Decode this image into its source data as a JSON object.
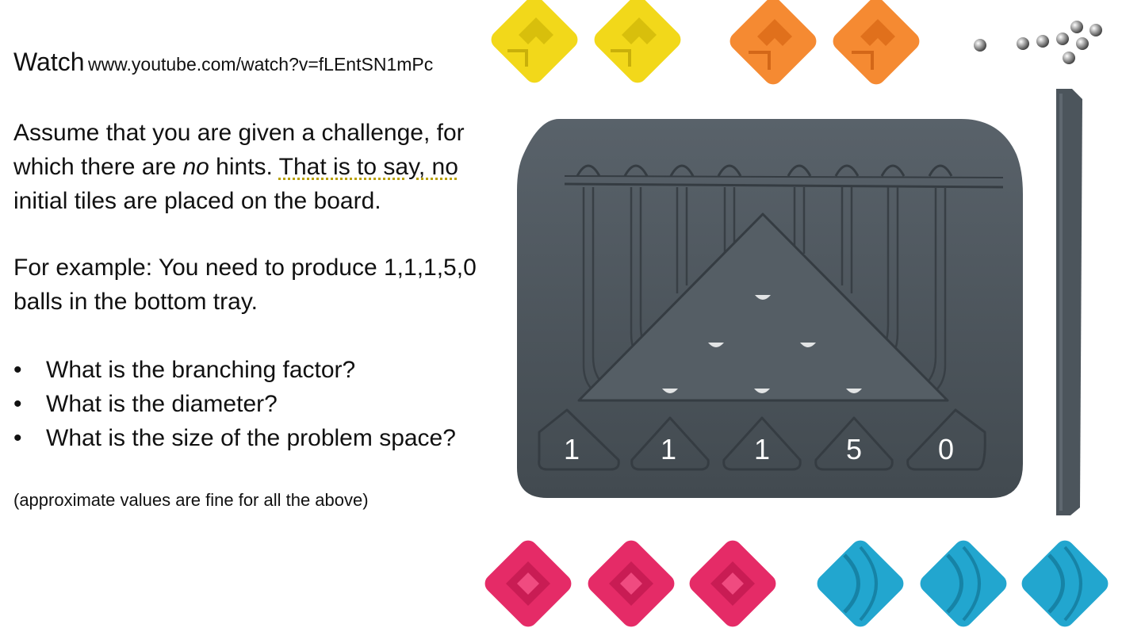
{
  "watch": {
    "label": "Watch",
    "url": "www.youtube.com/watch?v=fLEntSN1mPc"
  },
  "intro": {
    "part1": "Assume that you are given a challenge, for which there are ",
    "emphasis": "no",
    "part2": " hints. ",
    "underlined": "That is to say, no",
    "part3": " initial tiles are placed on the board."
  },
  "example": {
    "text": "For example: You need to produce 1,1,1,5,0 balls in the bottom tray."
  },
  "questions": [
    "What is the branching factor?",
    "What is the diameter?",
    "What is the size of the problem space?"
  ],
  "bullet_char": "•",
  "note": "(approximate values are fine for all the above)",
  "tray_counts": [
    "1",
    "1",
    "1",
    "5",
    "0"
  ],
  "colors": {
    "board": "#4c555c",
    "yellow": "#f2d81a",
    "orange": "#f58a32",
    "pink": "#e52b67",
    "blue": "#22a6cf",
    "steel": "#9a9a9a"
  }
}
